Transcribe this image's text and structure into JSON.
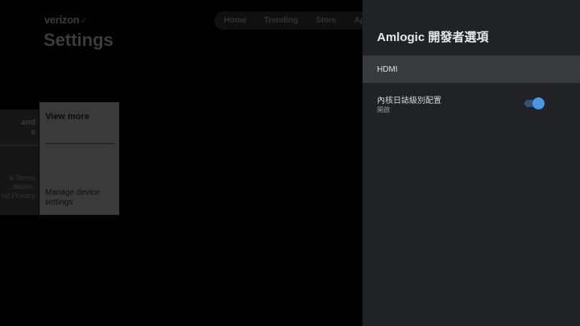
{
  "background": {
    "brand": "verizon",
    "brand_mark": "✓",
    "title": "Settings",
    "nav": [
      "Home",
      "Trending",
      "Store",
      "Ap"
    ],
    "left_card": {
      "heading": "and\ns",
      "text": "e Terms\nditions,\nnd Privacy"
    },
    "main_card": {
      "heading": "View more",
      "text": "Manage device\nsettings"
    }
  },
  "panel": {
    "title": "Amlogic 開發者選項",
    "items": [
      {
        "label": "HDMI"
      },
      {
        "label": "內核日誌級別配置",
        "sublabel": "開啟",
        "toggle_on": true
      }
    ]
  },
  "colors": {
    "panel_bg": "#212225",
    "focused_row": "#393a3e",
    "toggle_on": "#4b95e4"
  }
}
